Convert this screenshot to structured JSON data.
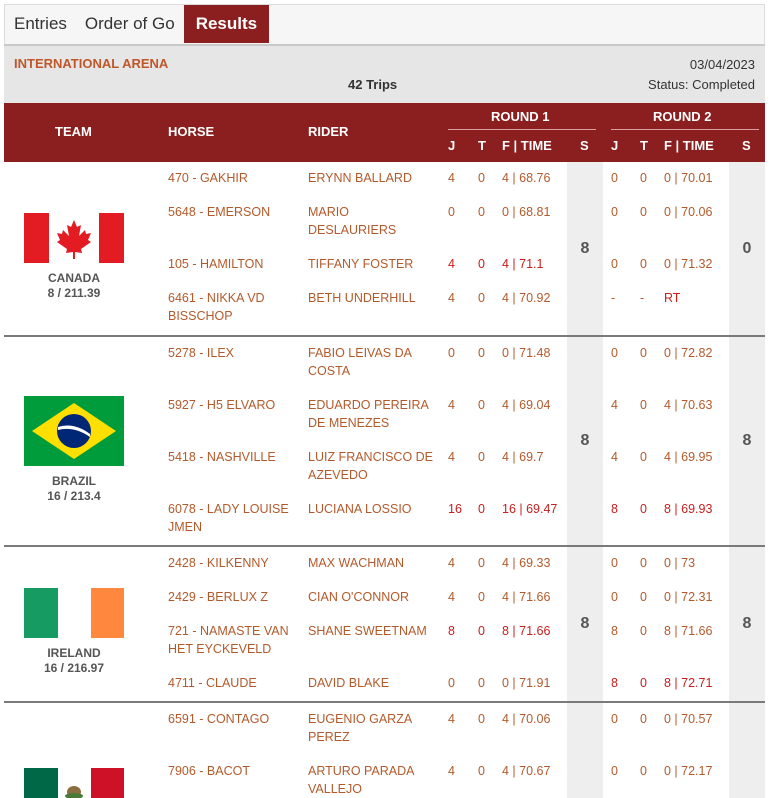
{
  "tabs": [
    {
      "label": "Entries",
      "active": false
    },
    {
      "label": "Order of Go",
      "active": false
    },
    {
      "label": "Results",
      "active": true
    }
  ],
  "info": {
    "arena": "INTERNATIONAL ARENA",
    "trips": "42 Trips",
    "date": "03/04/2023",
    "status": "Status: Completed"
  },
  "header": {
    "team": "TEAM",
    "horse": "HORSE",
    "rider": "RIDER",
    "round1": "ROUND 1",
    "round2": "ROUND 2",
    "j": "J",
    "t": "T",
    "ftime": "F | TIME",
    "s": "S"
  },
  "colors": {
    "accent": "#8b1e1e",
    "link": "#b35a2b",
    "fault": "#c81e1e"
  },
  "teams": [
    {
      "name": "CANADA",
      "score": "8 / 211.39",
      "flag": "canada-flag-icon",
      "round1_score": "8",
      "round2_score": "0",
      "rows": [
        {
          "horse": "470 - GAKHIR",
          "rider": "ERYNN BALLARD",
          "r1": {
            "j": "4",
            "t": "0",
            "ft": "4 | 68.76",
            "counts": false
          },
          "r2": {
            "j": "0",
            "t": "0",
            "ft": "0 | 70.01",
            "counts": false
          }
        },
        {
          "horse": "5648 - EMERSON",
          "rider": "MARIO DESLAURIERS",
          "r1": {
            "j": "0",
            "t": "0",
            "ft": "0 | 68.81",
            "counts": false
          },
          "r2": {
            "j": "0",
            "t": "0",
            "ft": "0 | 70.06",
            "counts": false
          }
        },
        {
          "horse": "105 - HAMILTON",
          "rider": "TIFFANY FOSTER",
          "r1": {
            "j": "4",
            "t": "0",
            "ft": "4 | 71.1",
            "counts": true
          },
          "r2": {
            "j": "0",
            "t": "0",
            "ft": "0 | 71.32",
            "counts": false
          }
        },
        {
          "horse": "6461 - NIKKA VD BISSCHOP",
          "rider": "BETH UNDERHILL",
          "r1": {
            "j": "4",
            "t": "0",
            "ft": "4 | 70.92",
            "counts": false
          },
          "r2": {
            "j": "-",
            "t": "-",
            "ft": "RT",
            "counts": false
          }
        }
      ]
    },
    {
      "name": "BRAZIL",
      "score": "16 / 213.4",
      "flag": "brazil-flag-icon",
      "round1_score": "8",
      "round2_score": "8",
      "rows": [
        {
          "horse": "5278 - ILEX",
          "rider": "FABIO LEIVAS DA COSTA",
          "r1": {
            "j": "0",
            "t": "0",
            "ft": "0 | 71.48",
            "counts": false
          },
          "r2": {
            "j": "0",
            "t": "0",
            "ft": "0 | 72.82",
            "counts": false
          }
        },
        {
          "horse": "5927 - H5 ELVARO",
          "rider": "EDUARDO PEREIRA DE MENEZES",
          "r1": {
            "j": "4",
            "t": "0",
            "ft": "4 | 69.04",
            "counts": false
          },
          "r2": {
            "j": "4",
            "t": "0",
            "ft": "4 | 70.63",
            "counts": false
          }
        },
        {
          "horse": "5418 - NASHVILLE",
          "rider": "LUIZ FRANCISCO DE AZEVEDO",
          "r1": {
            "j": "4",
            "t": "0",
            "ft": "4 | 69.7",
            "counts": false
          },
          "r2": {
            "j": "4",
            "t": "0",
            "ft": "4 | 69.95",
            "counts": false
          }
        },
        {
          "horse": "6078 - LADY LOUISE JMEN",
          "rider": "LUCIANA LOSSIO",
          "r1": {
            "j": "16",
            "t": "0",
            "ft": "16 | 69.47",
            "counts": true
          },
          "r2": {
            "j": "8",
            "t": "0",
            "ft": "8 | 69.93",
            "counts": true
          }
        }
      ]
    },
    {
      "name": "IRELAND",
      "score": "16 / 216.97",
      "flag": "ireland-flag-icon",
      "round1_score": "8",
      "round2_score": "8",
      "rows": [
        {
          "horse": "2428 - KILKENNY",
          "rider": "MAX WACHMAN",
          "r1": {
            "j": "4",
            "t": "0",
            "ft": "4 | 69.33",
            "counts": false
          },
          "r2": {
            "j": "0",
            "t": "0",
            "ft": "0 | 73",
            "counts": false
          }
        },
        {
          "horse": "2429 - BERLUX Z",
          "rider": "CIAN O'CONNOR",
          "r1": {
            "j": "4",
            "t": "0",
            "ft": "4 | 71.66",
            "counts": false
          },
          "r2": {
            "j": "0",
            "t": "0",
            "ft": "0 | 72.31",
            "counts": false
          }
        },
        {
          "horse": "721 - NAMASTE VAN HET EYCKEVELD",
          "rider": "SHANE SWEETNAM",
          "r1": {
            "j": "8",
            "t": "0",
            "ft": "8 | 71.66",
            "counts": true
          },
          "r2": {
            "j": "8",
            "t": "0",
            "ft": "8 | 71.66",
            "counts": false
          }
        },
        {
          "horse": "4711 - CLAUDE",
          "rider": "DAVID BLAKE",
          "r1": {
            "j": "0",
            "t": "0",
            "ft": "0 | 71.91",
            "counts": false
          },
          "r2": {
            "j": "8",
            "t": "0",
            "ft": "8 | 72.71",
            "counts": true
          }
        }
      ]
    },
    {
      "name": "",
      "score": "",
      "flag": "mexico-flag-icon",
      "round1_score": "",
      "round2_score": "",
      "rows": [
        {
          "horse": "6591 - CONTAGO",
          "rider": "EUGENIO GARZA PEREZ",
          "r1": {
            "j": "4",
            "t": "0",
            "ft": "4 | 70.06",
            "counts": false
          },
          "r2": {
            "j": "0",
            "t": "0",
            "ft": "0 | 70.57",
            "counts": false
          }
        },
        {
          "horse": "7906 - BACOT",
          "rider": "ARTURO PARADA VALLEJO",
          "r1": {
            "j": "4",
            "t": "0",
            "ft": "4 | 70.67",
            "counts": false
          },
          "r2": {
            "j": "0",
            "t": "0",
            "ft": "0 | 72.17",
            "counts": false
          }
        }
      ]
    }
  ]
}
